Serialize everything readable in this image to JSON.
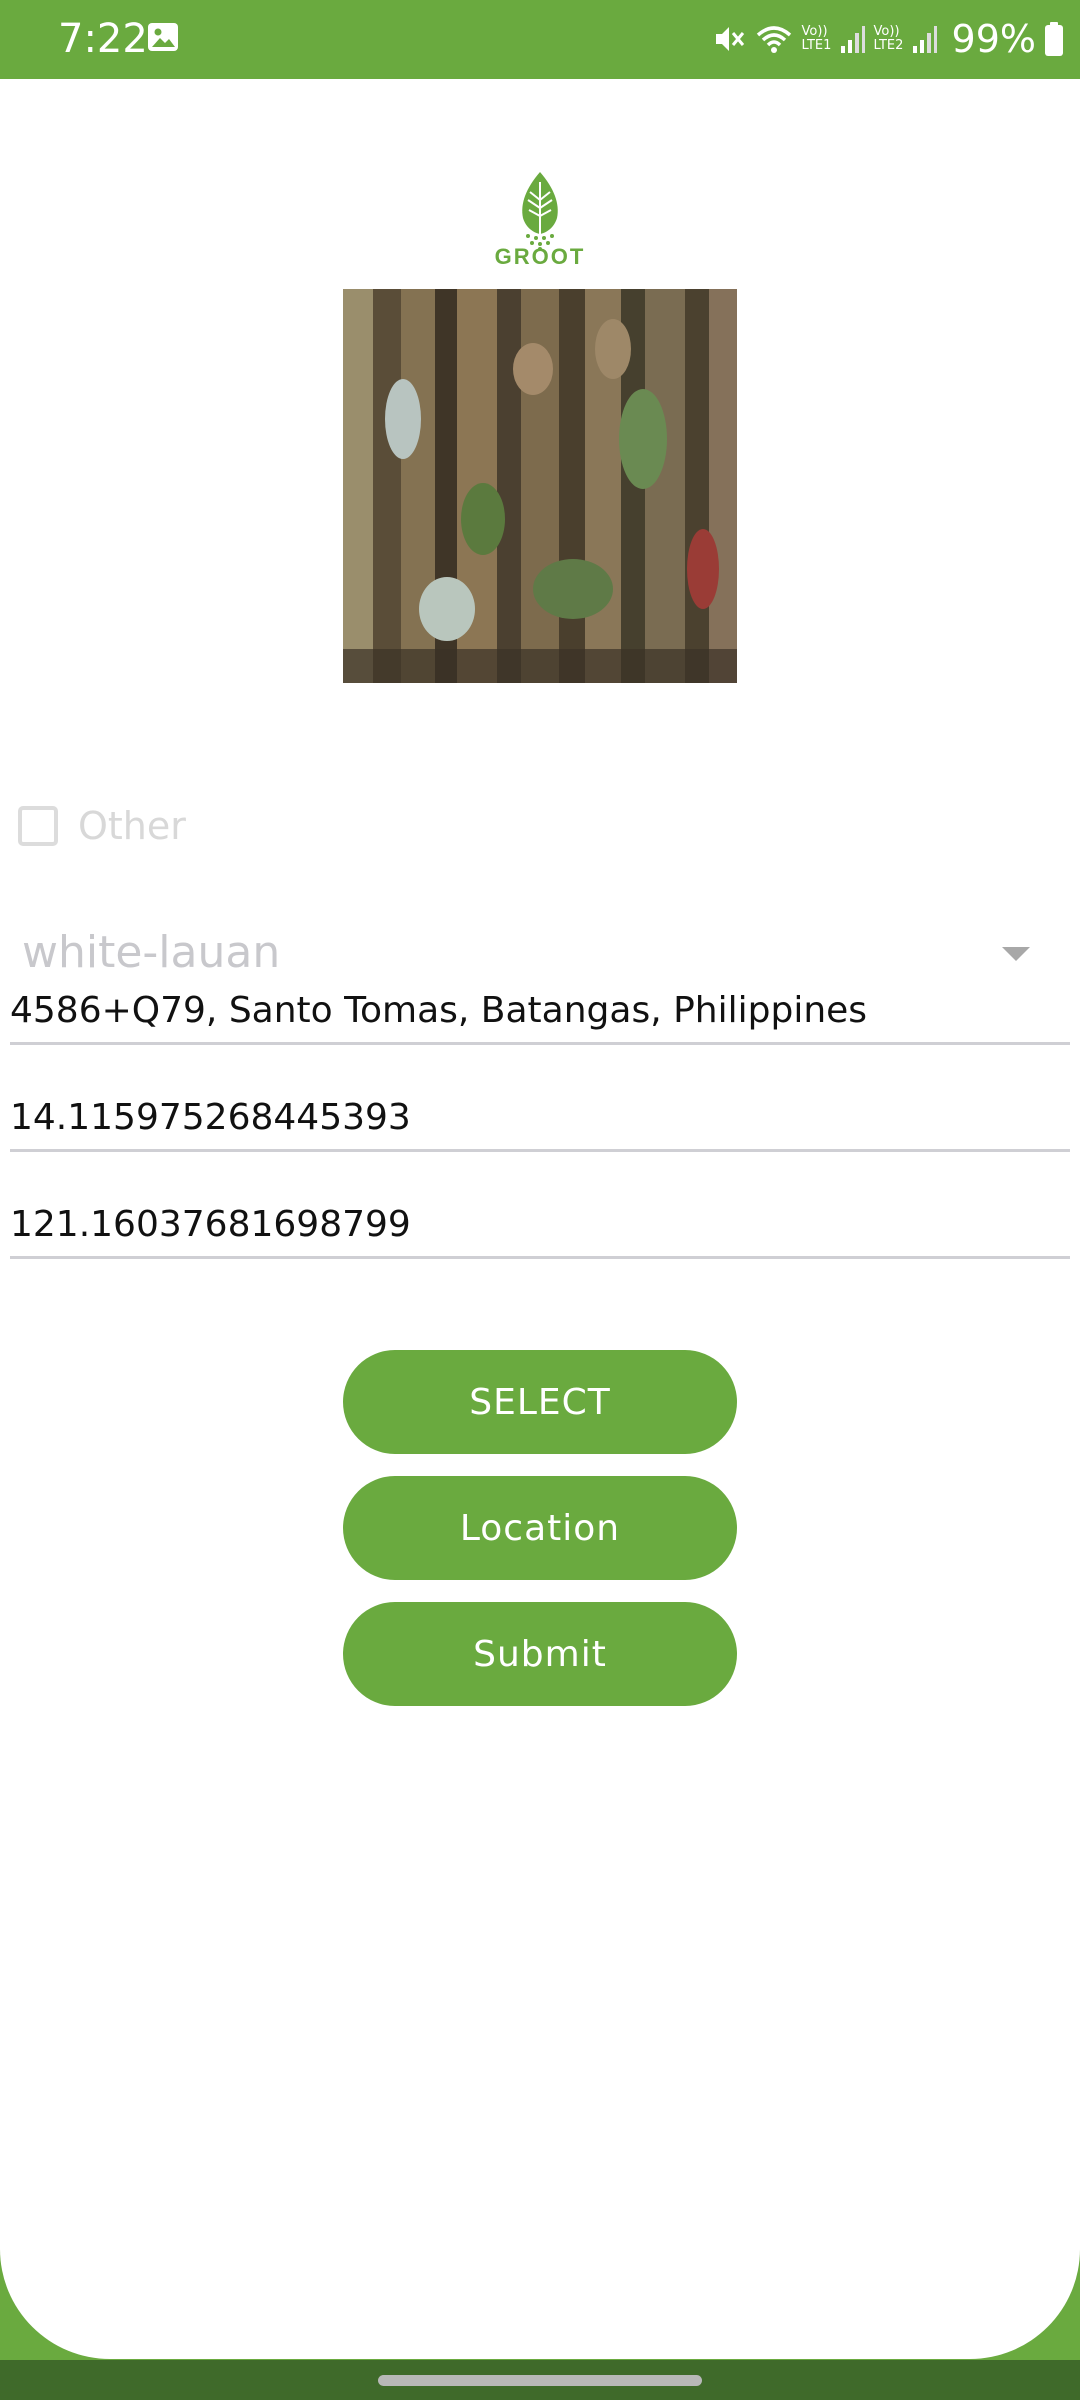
{
  "status_bar": {
    "time": "7:22",
    "network_1": "Vo)) LTE1",
    "network_2": "Vo)) LTE2",
    "battery": "99%",
    "icons": [
      "gallery-icon",
      "mute-icon",
      "wifi-icon",
      "signal-icon",
      "battery-icon"
    ]
  },
  "logo": {
    "text": "GROOT",
    "icon": "leaf-logo-icon"
  },
  "form": {
    "other_checkbox_label": "Other",
    "other_checked": false,
    "species_selected": "white-lauan",
    "address": "4586+Q79, Santo Tomas, Batangas, Philippines",
    "latitude": "14.115975268445393",
    "longitude": "121.16037681698799"
  },
  "buttons": {
    "select": "SELECT",
    "location": "Location",
    "submit": "Submit"
  },
  "colors": {
    "accent": "#6aaa3f",
    "nav_bar": "#3f6a2a"
  }
}
